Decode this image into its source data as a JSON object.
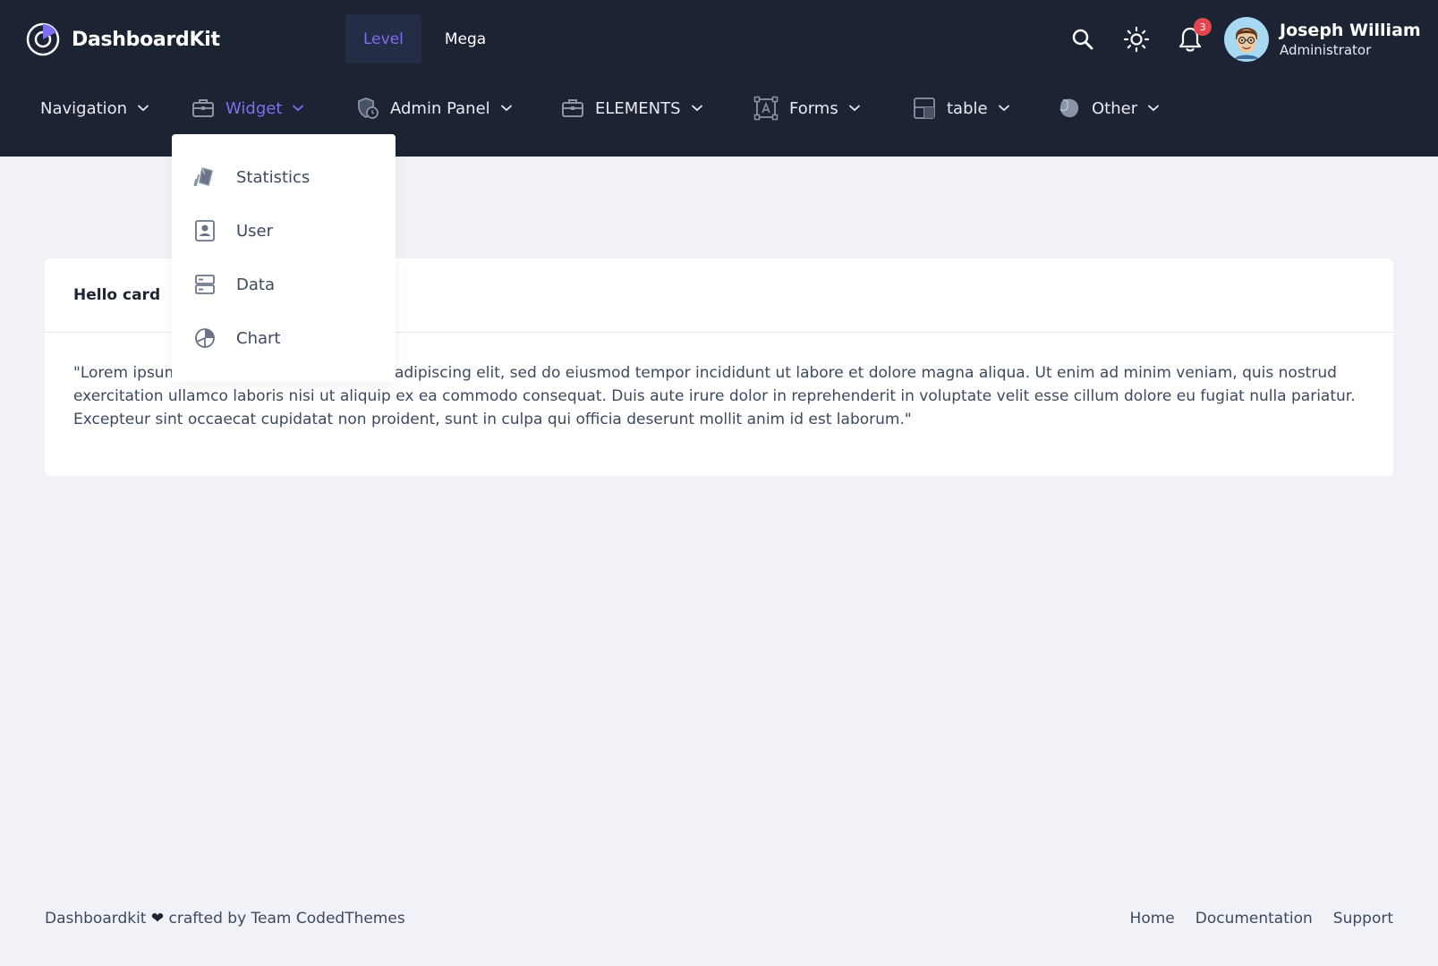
{
  "app": {
    "title": "DashboardKit"
  },
  "header": {
    "tabs": [
      {
        "label": "Level",
        "active": true
      },
      {
        "label": "Mega",
        "active": false
      }
    ],
    "notifications_count": "3",
    "user": {
      "name": "Joseph William",
      "role": "Administrator"
    }
  },
  "menu": {
    "items": [
      {
        "label": "Navigation",
        "icon": "none"
      },
      {
        "label": "Widget",
        "icon": "briefcase-icon",
        "active": true
      },
      {
        "label": "Admin Panel",
        "icon": "shield-clock-icon"
      },
      {
        "label": "ELEMENTS",
        "icon": "briefcase-icon"
      },
      {
        "label": "Forms",
        "icon": "text-frame-icon"
      },
      {
        "label": "table",
        "icon": "layout-table-icon"
      },
      {
        "label": "Other",
        "icon": "blob-icon"
      }
    ]
  },
  "dropdown": {
    "items": [
      {
        "label": "Statistics",
        "icon": "statistics-icon"
      },
      {
        "label": "User",
        "icon": "user-card-icon"
      },
      {
        "label": "Data",
        "icon": "server-icon"
      },
      {
        "label": "Chart",
        "icon": "pie-chart-icon"
      }
    ]
  },
  "card": {
    "title": "Hello card",
    "body": "\"Lorem ipsum dolor sit amet, consectetur adipiscing elit, sed do eiusmod tempor incididunt ut labore et dolore magna aliqua. Ut enim ad minim veniam, quis nostrud exercitation ullamco laboris nisi ut aliquip ex ea commodo consequat. Duis aute irure dolor in reprehenderit in voluptate velit esse cillum dolore eu fugiat nulla pariatur. Excepteur sint occaecat cupidatat non proident, sunt in culpa qui officia deserunt mollit anim id est laborum.\""
  },
  "footer": {
    "credit_prefix": "Dashboardkit",
    "credit_suffix": "crafted by Team CodedThemes",
    "links": [
      "Home",
      "Documentation",
      "Support"
    ]
  },
  "colors": {
    "topbar": "#1c2333",
    "accent": "#7c6ff0",
    "background": "#f0f2f7",
    "badge": "#e3464f"
  }
}
